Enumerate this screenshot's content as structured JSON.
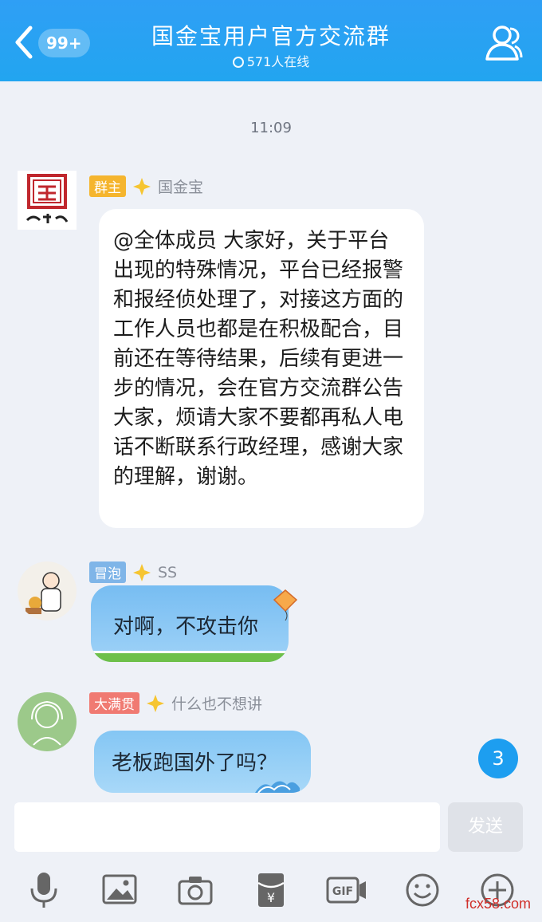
{
  "header": {
    "back_badge": "99+",
    "title": "国金宝用户官方交流群",
    "online": "571人在线"
  },
  "chat": {
    "timestamp": "11:09",
    "messages": [
      {
        "role_tag": "群主",
        "role_color": "#f5b52e",
        "sender": "国金宝",
        "avatar_text": "国金宝",
        "text": "@全体成员 大家好，关于平台出现的特殊情况，平台已经报警和报经侦处理了，对接这方面的工作人员也都是在积极配合，目前还在等待结果，后续有更进一步的情况，会在官方交流群公告大家，烦请大家不要都再私人电话不断联系行政经理，感谢大家的理解，谢谢。"
      },
      {
        "role_tag": "冒泡",
        "role_color": "#7fb5e8",
        "sender": "SS",
        "text": "对啊，不攻击你"
      },
      {
        "role_tag": "大满贯",
        "role_color": "#f07a72",
        "sender": "什么也不想讲",
        "text": "老板跑国外了吗？"
      }
    ],
    "unread_count": "3"
  },
  "input": {
    "send_label": "发送"
  },
  "toolbar": {
    "items": [
      "mic-icon",
      "image-icon",
      "camera-icon",
      "red-packet-icon",
      "gif-icon",
      "emoji-icon",
      "plus-icon"
    ]
  },
  "watermark": "fcx58.com"
}
